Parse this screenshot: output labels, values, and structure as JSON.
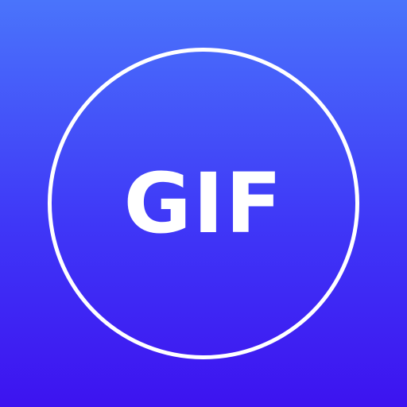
{
  "icon": {
    "text": "GIF",
    "colors": {
      "gradient_top": "#4a74fb",
      "gradient_bottom": "#3d13f0",
      "foreground": "#ffffff"
    }
  }
}
